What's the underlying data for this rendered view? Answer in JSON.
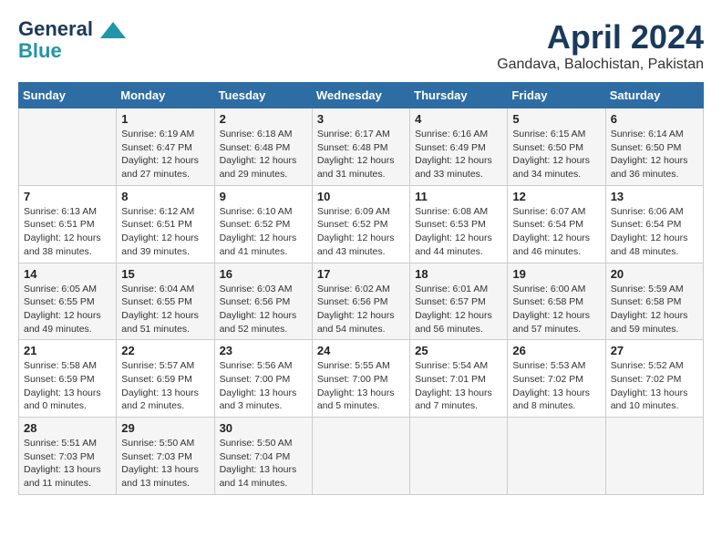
{
  "header": {
    "logo_line1": "General",
    "logo_line2": "Blue",
    "month": "April 2024",
    "location": "Gandava, Balochistan, Pakistan"
  },
  "weekdays": [
    "Sunday",
    "Monday",
    "Tuesday",
    "Wednesday",
    "Thursday",
    "Friday",
    "Saturday"
  ],
  "weeks": [
    [
      {
        "day": "",
        "info": ""
      },
      {
        "day": "1",
        "info": "Sunrise: 6:19 AM\nSunset: 6:47 PM\nDaylight: 12 hours\nand 27 minutes."
      },
      {
        "day": "2",
        "info": "Sunrise: 6:18 AM\nSunset: 6:48 PM\nDaylight: 12 hours\nand 29 minutes."
      },
      {
        "day": "3",
        "info": "Sunrise: 6:17 AM\nSunset: 6:48 PM\nDaylight: 12 hours\nand 31 minutes."
      },
      {
        "day": "4",
        "info": "Sunrise: 6:16 AM\nSunset: 6:49 PM\nDaylight: 12 hours\nand 33 minutes."
      },
      {
        "day": "5",
        "info": "Sunrise: 6:15 AM\nSunset: 6:50 PM\nDaylight: 12 hours\nand 34 minutes."
      },
      {
        "day": "6",
        "info": "Sunrise: 6:14 AM\nSunset: 6:50 PM\nDaylight: 12 hours\nand 36 minutes."
      }
    ],
    [
      {
        "day": "7",
        "info": "Sunrise: 6:13 AM\nSunset: 6:51 PM\nDaylight: 12 hours\nand 38 minutes."
      },
      {
        "day": "8",
        "info": "Sunrise: 6:12 AM\nSunset: 6:51 PM\nDaylight: 12 hours\nand 39 minutes."
      },
      {
        "day": "9",
        "info": "Sunrise: 6:10 AM\nSunset: 6:52 PM\nDaylight: 12 hours\nand 41 minutes."
      },
      {
        "day": "10",
        "info": "Sunrise: 6:09 AM\nSunset: 6:52 PM\nDaylight: 12 hours\nand 43 minutes."
      },
      {
        "day": "11",
        "info": "Sunrise: 6:08 AM\nSunset: 6:53 PM\nDaylight: 12 hours\nand 44 minutes."
      },
      {
        "day": "12",
        "info": "Sunrise: 6:07 AM\nSunset: 6:54 PM\nDaylight: 12 hours\nand 46 minutes."
      },
      {
        "day": "13",
        "info": "Sunrise: 6:06 AM\nSunset: 6:54 PM\nDaylight: 12 hours\nand 48 minutes."
      }
    ],
    [
      {
        "day": "14",
        "info": "Sunrise: 6:05 AM\nSunset: 6:55 PM\nDaylight: 12 hours\nand 49 minutes."
      },
      {
        "day": "15",
        "info": "Sunrise: 6:04 AM\nSunset: 6:55 PM\nDaylight: 12 hours\nand 51 minutes."
      },
      {
        "day": "16",
        "info": "Sunrise: 6:03 AM\nSunset: 6:56 PM\nDaylight: 12 hours\nand 52 minutes."
      },
      {
        "day": "17",
        "info": "Sunrise: 6:02 AM\nSunset: 6:56 PM\nDaylight: 12 hours\nand 54 minutes."
      },
      {
        "day": "18",
        "info": "Sunrise: 6:01 AM\nSunset: 6:57 PM\nDaylight: 12 hours\nand 56 minutes."
      },
      {
        "day": "19",
        "info": "Sunrise: 6:00 AM\nSunset: 6:58 PM\nDaylight: 12 hours\nand 57 minutes."
      },
      {
        "day": "20",
        "info": "Sunrise: 5:59 AM\nSunset: 6:58 PM\nDaylight: 12 hours\nand 59 minutes."
      }
    ],
    [
      {
        "day": "21",
        "info": "Sunrise: 5:58 AM\nSunset: 6:59 PM\nDaylight: 13 hours\nand 0 minutes."
      },
      {
        "day": "22",
        "info": "Sunrise: 5:57 AM\nSunset: 6:59 PM\nDaylight: 13 hours\nand 2 minutes."
      },
      {
        "day": "23",
        "info": "Sunrise: 5:56 AM\nSunset: 7:00 PM\nDaylight: 13 hours\nand 3 minutes."
      },
      {
        "day": "24",
        "info": "Sunrise: 5:55 AM\nSunset: 7:00 PM\nDaylight: 13 hours\nand 5 minutes."
      },
      {
        "day": "25",
        "info": "Sunrise: 5:54 AM\nSunset: 7:01 PM\nDaylight: 13 hours\nand 7 minutes."
      },
      {
        "day": "26",
        "info": "Sunrise: 5:53 AM\nSunset: 7:02 PM\nDaylight: 13 hours\nand 8 minutes."
      },
      {
        "day": "27",
        "info": "Sunrise: 5:52 AM\nSunset: 7:02 PM\nDaylight: 13 hours\nand 10 minutes."
      }
    ],
    [
      {
        "day": "28",
        "info": "Sunrise: 5:51 AM\nSunset: 7:03 PM\nDaylight: 13 hours\nand 11 minutes."
      },
      {
        "day": "29",
        "info": "Sunrise: 5:50 AM\nSunset: 7:03 PM\nDaylight: 13 hours\nand 13 minutes."
      },
      {
        "day": "30",
        "info": "Sunrise: 5:50 AM\nSunset: 7:04 PM\nDaylight: 13 hours\nand 14 minutes."
      },
      {
        "day": "",
        "info": ""
      },
      {
        "day": "",
        "info": ""
      },
      {
        "day": "",
        "info": ""
      },
      {
        "day": "",
        "info": ""
      }
    ]
  ]
}
